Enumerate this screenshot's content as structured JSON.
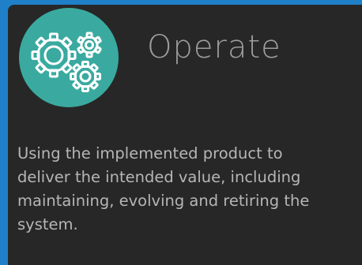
{
  "card": {
    "icon": "gears-icon",
    "title": "Operate",
    "description_lines": [
      "Using the implemented product to",
      "deliver the intended value, including",
      "maintaining, evolving and retiring the",
      "system."
    ]
  },
  "colors": {
    "frame_border": "#1f7fc8",
    "card_background": "#272727",
    "icon_circle": "#3aaaa0",
    "icon_stroke": "#ffffff",
    "title_text": "#9d9d9d",
    "body_text": "#b6b6b6"
  }
}
